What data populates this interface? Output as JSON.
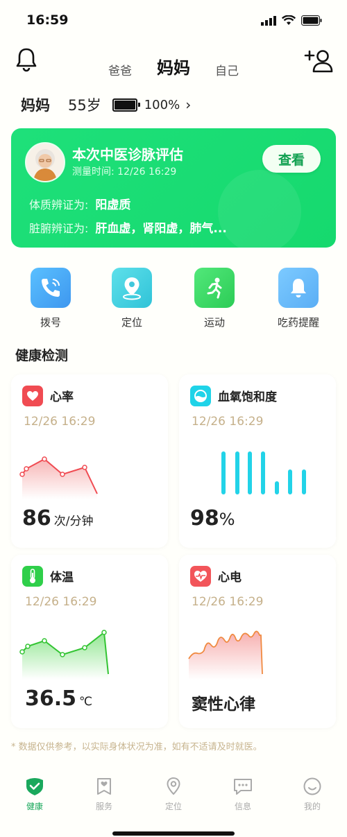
{
  "status": {
    "time": "16:59"
  },
  "header": {
    "tabs": [
      {
        "label": "爸爸"
      },
      {
        "label": "妈妈"
      },
      {
        "label": "自己"
      }
    ]
  },
  "profile": {
    "name": "妈妈",
    "age": "55岁",
    "battery": "100%",
    "battery_level": 1.0,
    "chevron": "›"
  },
  "assessment": {
    "title": "本次中医诊脉评估",
    "time": "测量时间: 12/26 16:29",
    "view_label": "查看",
    "constitution_label": "体质辨证为:",
    "constitution_value": "阳虚质",
    "organ_label": "脏腑辨证为:",
    "organ_value": "肝血虚，肾阳虚，肺气..."
  },
  "quick_actions": [
    {
      "label": "拨号",
      "icon": "phone-icon",
      "color": "#47a7f5"
    },
    {
      "label": "定位",
      "icon": "location-icon",
      "color": "#3fd0e0"
    },
    {
      "label": "运动",
      "icon": "running-icon",
      "color": "#38d968"
    },
    {
      "label": "吃药提醒",
      "icon": "bell-icon",
      "color": "#5bb6f7"
    }
  ],
  "section_title": "健康检测",
  "cards": {
    "heart": {
      "name": "心率",
      "time": "12/26 16:29",
      "value": "86",
      "unit": "次/分钟",
      "icon": "heart-icon",
      "color": "#f04b52"
    },
    "spo2": {
      "name": "血氧饱和度",
      "time": "12/26 16:29",
      "value": "98",
      "unit": "%",
      "icon": "oxygen-icon",
      "color": "#1fd3e8"
    },
    "temp": {
      "name": "体温",
      "time": "12/26 16:29",
      "value": "36.5",
      "unit": "℃",
      "icon": "thermometer-icon",
      "color": "#2fcf4a"
    },
    "ecg": {
      "name": "心电",
      "time": "12/26 16:29",
      "value": "窦性心律",
      "icon": "ecg-icon",
      "color": "#f2555a"
    }
  },
  "footnote": "* 数据仅供参考，以实际身体状况为准，如有不适请及时就医。",
  "nav": [
    {
      "label": "健康",
      "icon": "heart-shield-icon"
    },
    {
      "label": "服务",
      "icon": "service-icon"
    },
    {
      "label": "定位",
      "icon": "location-pin-icon"
    },
    {
      "label": "信息",
      "icon": "message-icon"
    },
    {
      "label": "我的",
      "icon": "smile-icon"
    }
  ],
  "colors": {
    "accent": "#1ee07a",
    "nav_active": "#1aa85c"
  }
}
